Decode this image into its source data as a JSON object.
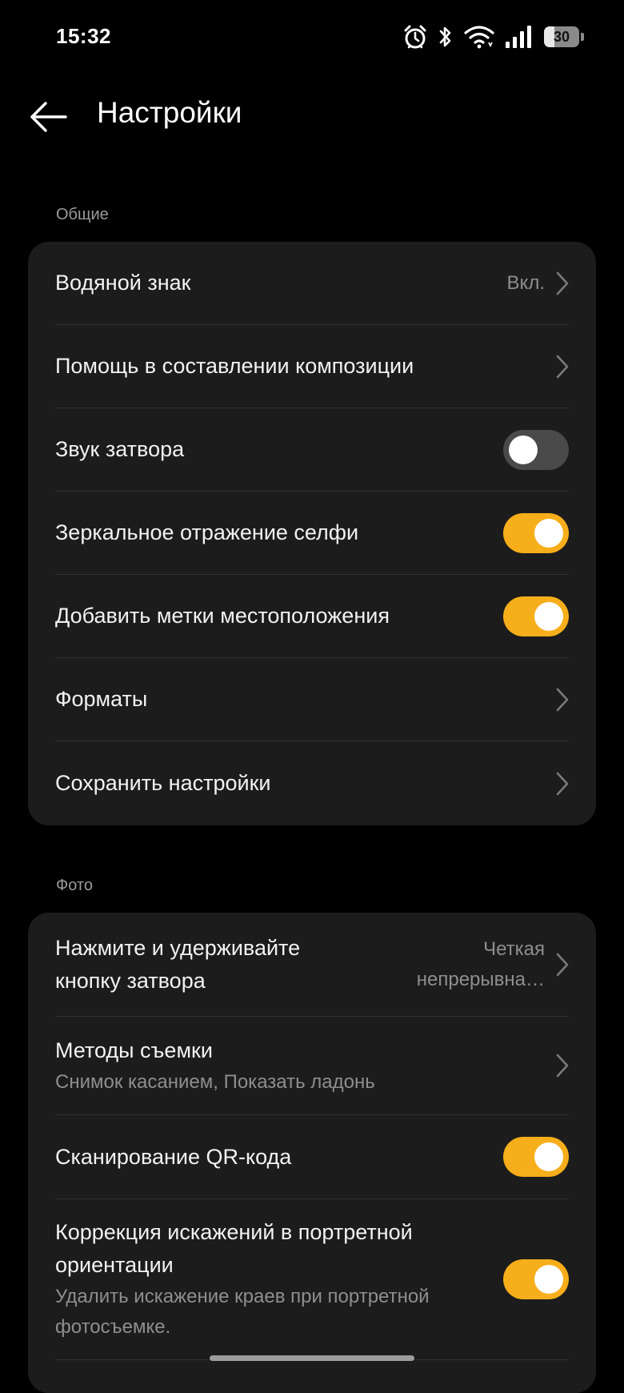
{
  "status_bar": {
    "time": "15:32",
    "battery_level": "30",
    "battery_fraction": 0.3,
    "icons": [
      "alarm-icon",
      "bluetooth-icon",
      "wifi-icon",
      "signal-icon",
      "battery-icon"
    ]
  },
  "header": {
    "title": "Настройки",
    "back_icon": "back-arrow-icon"
  },
  "colors": {
    "background": "#000000",
    "card": "#1c1c1c",
    "accent": "#f7ae1b",
    "toggle_off": "#4a4a4a",
    "secondary_text": "#8e8e8e"
  },
  "sections": [
    {
      "label": "Общие",
      "rows": [
        {
          "title": "Водяной знак",
          "value": "Вкл.",
          "type": "chevron"
        },
        {
          "title": "Помощь в составлении композиции",
          "type": "chevron"
        },
        {
          "title": "Звук затвора",
          "type": "toggle",
          "on": false
        },
        {
          "title": "Зеркальное отражение селфи",
          "type": "toggle",
          "on": true
        },
        {
          "title": "Добавить метки местоположения",
          "type": "toggle",
          "on": true
        },
        {
          "title": "Форматы",
          "type": "chevron"
        },
        {
          "title": "Сохранить настройки",
          "type": "chevron"
        }
      ]
    },
    {
      "label": "Фото",
      "rows": [
        {
          "title_line1": "Нажмите и удерживайте",
          "title_line2": "кнопку затвора",
          "value_line1": "Четкая",
          "value_line2": "непрерывна…",
          "type": "chevron"
        },
        {
          "title": "Методы съемки",
          "subtitle": "Снимок касанием, Показать ладонь",
          "type": "chevron"
        },
        {
          "title": "Сканирование QR-кода",
          "type": "toggle",
          "on": true
        },
        {
          "title_line1": "Коррекция искажений в портретной",
          "title_line2": "ориентации",
          "subtitle_line1": "Удалить искажение краев при портретной",
          "subtitle_line2": "фотосъемке.",
          "type": "toggle",
          "on": true
        }
      ]
    }
  ]
}
